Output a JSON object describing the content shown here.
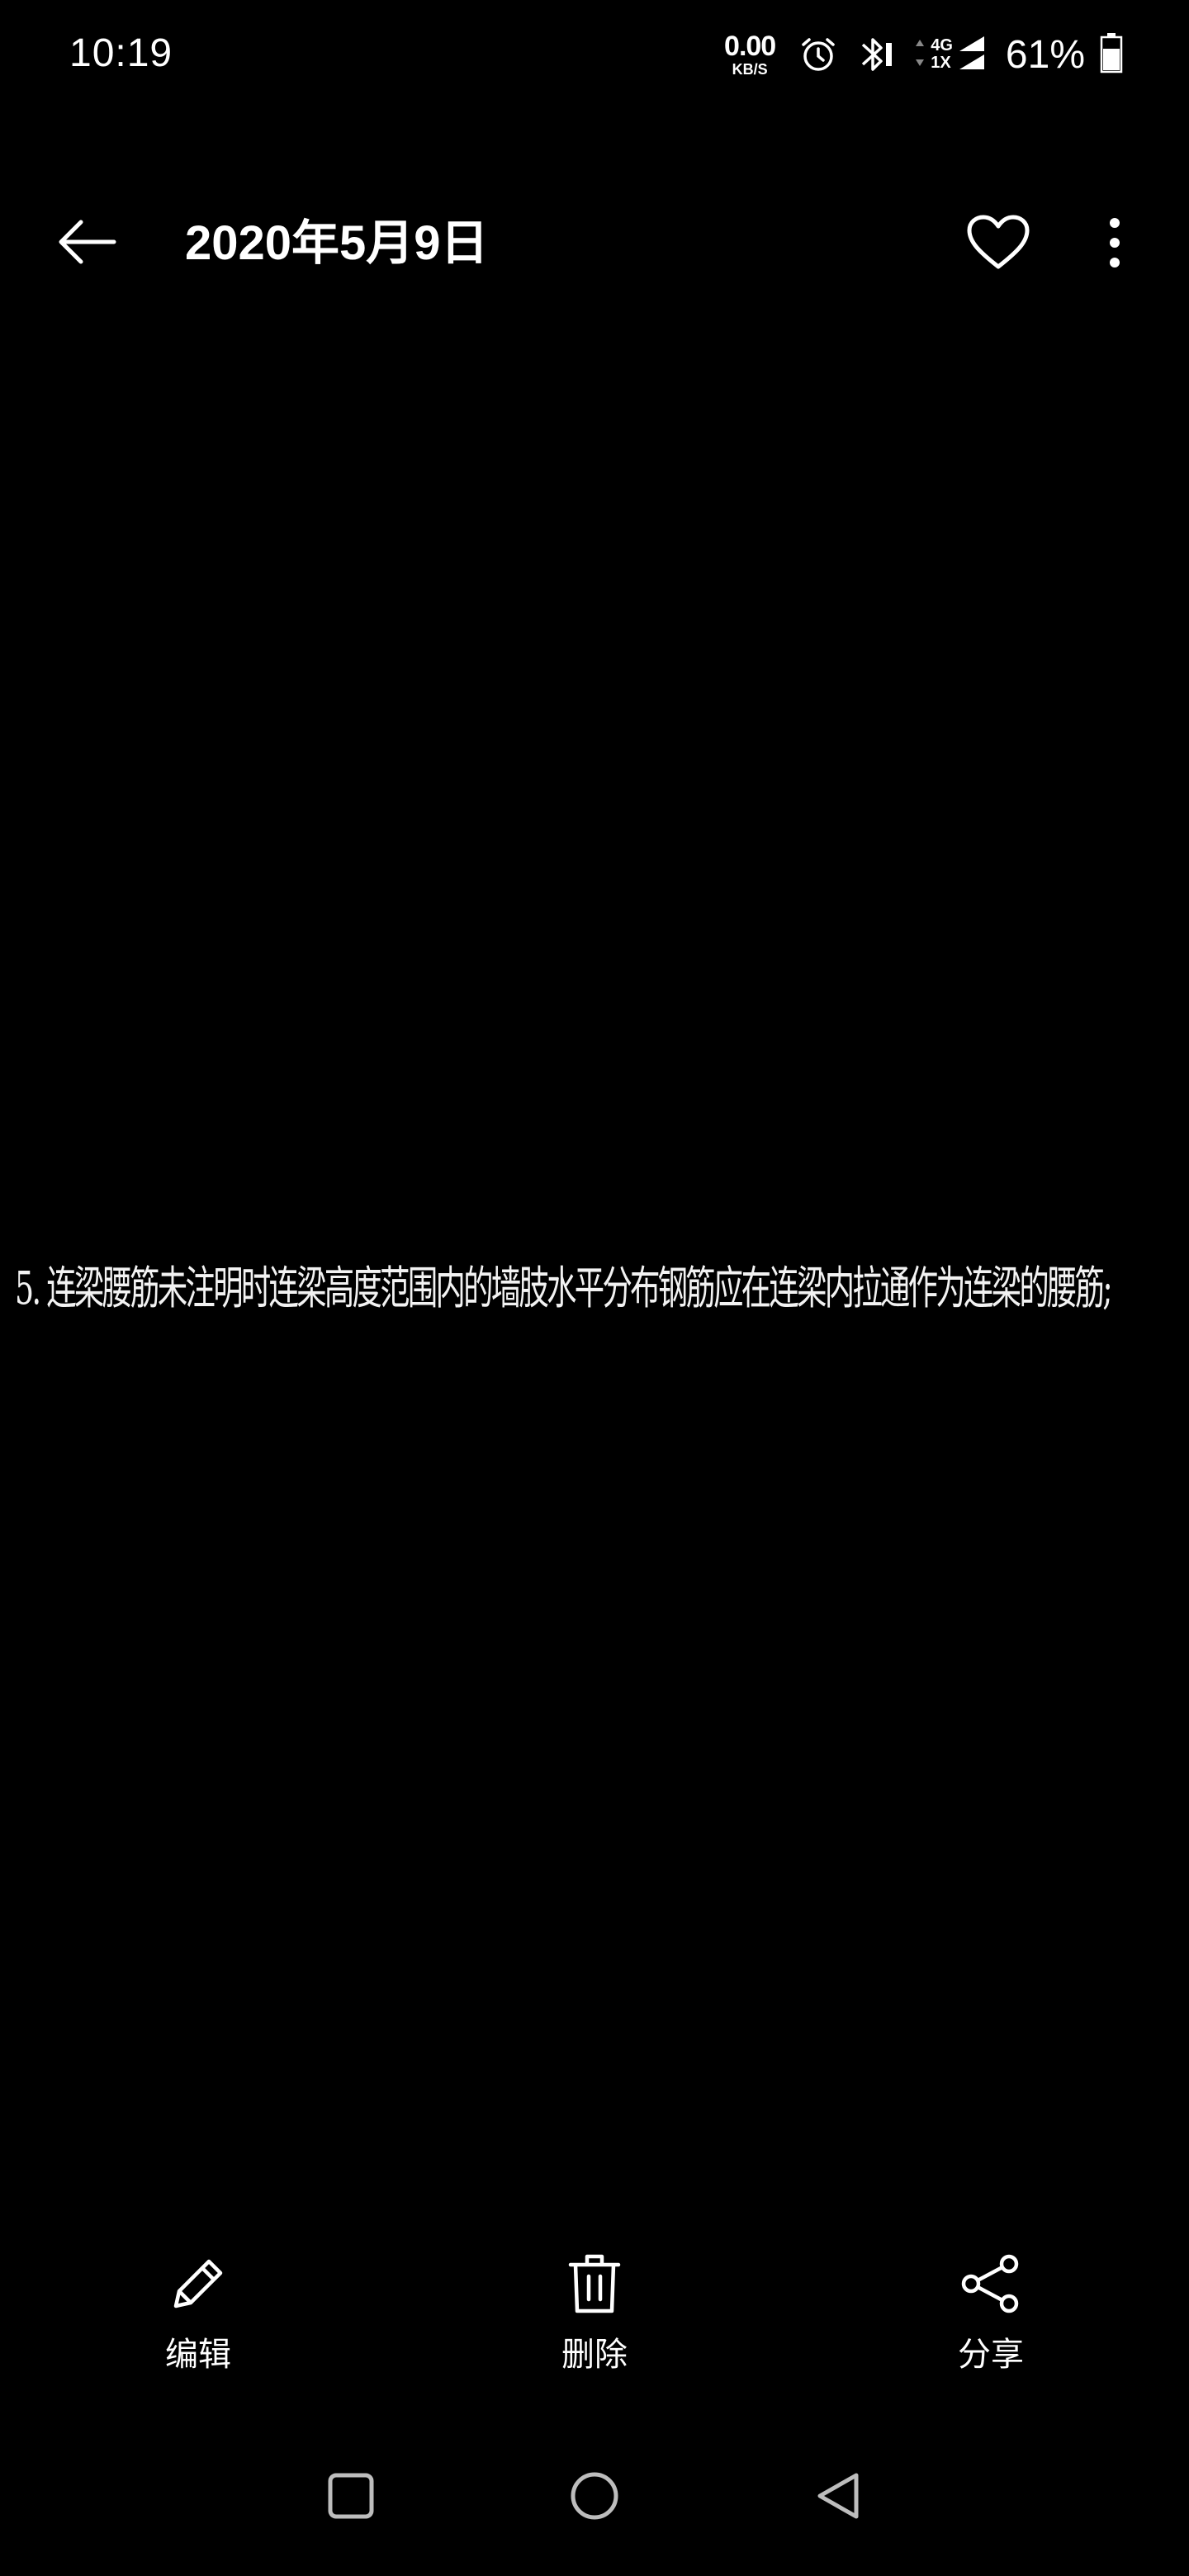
{
  "status_bar": {
    "time": "10:19",
    "net_speed_value": "0.00",
    "net_speed_unit": "KB/S",
    "signal_top": "4G",
    "signal_bottom": "1X",
    "battery_percent": "61%"
  },
  "app_bar": {
    "title": "2020年5月9日",
    "back_icon": "arrow-left-icon",
    "favorite_icon": "heart-outline-icon",
    "more_icon": "more-vertical-icon"
  },
  "photo": {
    "text": "5. 连梁腰筋未注明时连梁高度范围内的墙肢水平分布钢筋应在连梁内拉通作为连梁的腰筋;"
  },
  "actions": {
    "edit_label": "编辑",
    "delete_label": "删除",
    "share_label": "分享"
  },
  "nav_bar": {
    "recents_icon": "square-icon",
    "home_icon": "circle-icon",
    "back_icon": "triangle-back-icon"
  },
  "colors": {
    "background": "#000000",
    "foreground": "#ffffff"
  }
}
